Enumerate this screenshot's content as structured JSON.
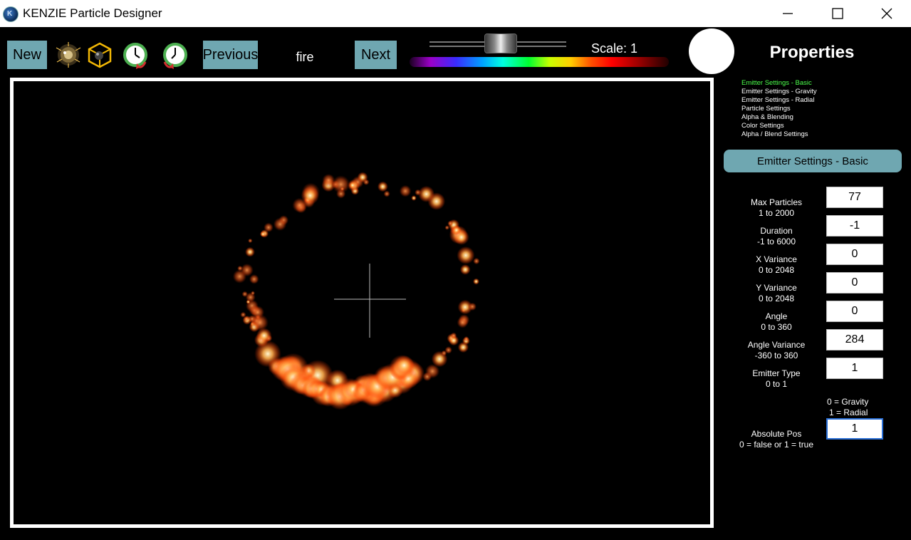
{
  "window": {
    "title": "KENZIE Particle Designer"
  },
  "toolbar": {
    "new_label": "New",
    "previous_label": "Previous",
    "next_label": "Next",
    "effect_name": "fire",
    "scale_label": "Scale: 1",
    "icons": [
      "particle-texture-icon",
      "emitter-cube-icon",
      "clock-undo-icon",
      "clock-redo-icon"
    ]
  },
  "properties": {
    "title": "Properties",
    "menu": [
      {
        "label": "Emitter Settings - Basic",
        "active": true
      },
      {
        "label": "Emitter Settings - Gravity",
        "active": false
      },
      {
        "label": "Emitter Settings - Radial",
        "active": false
      },
      {
        "label": "Particle Settings",
        "active": false
      },
      {
        "label": "Alpha & Blending",
        "active": false
      },
      {
        "label": "Color Settings",
        "active": false
      },
      {
        "label": "Alpha / Blend Settings",
        "active": false
      }
    ],
    "section_title": "Emitter Settings - Basic",
    "fields": [
      {
        "name": "Max Particles",
        "range": "1 to 2000",
        "value": "77"
      },
      {
        "name": "Duration",
        "range": "-1 to 6000",
        "value": "-1"
      },
      {
        "name": "X Variance",
        "range": "0 to 2048",
        "value": "0"
      },
      {
        "name": "Y Variance",
        "range": "0 to 2048",
        "value": "0"
      },
      {
        "name": "Angle",
        "range": "0 to 360",
        "value": "0"
      },
      {
        "name": "Angle Variance",
        "range": "-360 to 360",
        "value": "284"
      },
      {
        "name": "Emitter Type",
        "range": "0 to 1",
        "value": "1"
      }
    ],
    "emitter_type_hint": [
      "0 = Gravity",
      "1 = Radial"
    ],
    "absolute_pos": {
      "name": "Absolute Pos",
      "range": "0 = false or 1 = true",
      "value": "1"
    }
  },
  "colors": {
    "button_bg": "#6fa7b1",
    "active_menu": "#4cff4c",
    "particle_core": "#fff6d0",
    "particle_glow": "#ff5a10"
  }
}
